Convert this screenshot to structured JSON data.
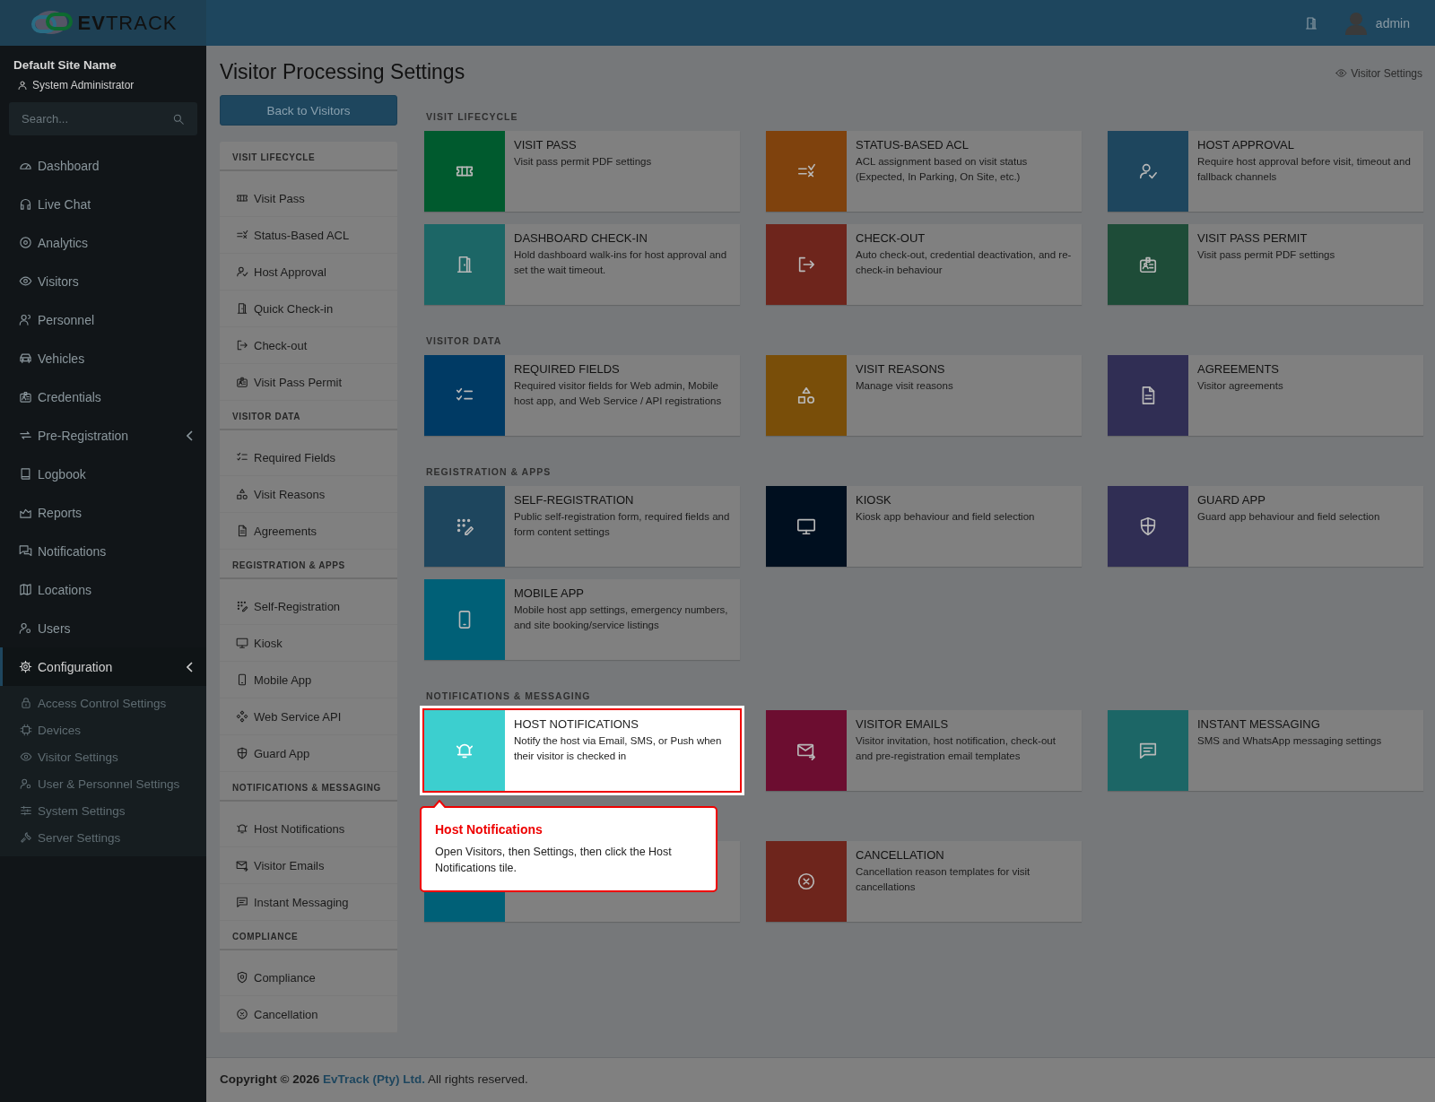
{
  "header": {
    "brand": "**EV**TRACK",
    "user": "admin"
  },
  "sidebar": {
    "site_name": "Default Site Name",
    "role": "System Administrator",
    "search": {
      "placeholder": "Search..."
    },
    "items": [
      {
        "label": "Dashboard",
        "kind": "link",
        "selected": false
      },
      {
        "label": "Live Chat",
        "kind": "link",
        "selected": false
      },
      {
        "label": "Analytics",
        "kind": "link",
        "selected": false
      },
      {
        "label": "Visitors",
        "kind": "link",
        "selected": false
      },
      {
        "label": "Personnel",
        "kind": "link",
        "selected": false
      },
      {
        "label": "Vehicles",
        "kind": "link",
        "selected": false
      },
      {
        "label": "Credentials",
        "kind": "link",
        "selected": false
      },
      {
        "label": "Pre-Registration",
        "kind": "group",
        "selected": false
      },
      {
        "label": "Logbook",
        "kind": "link",
        "selected": false
      },
      {
        "label": "Reports",
        "kind": "link",
        "selected": false
      },
      {
        "label": "Notifications",
        "kind": "link",
        "selected": false
      },
      {
        "label": "Locations",
        "kind": "link",
        "selected": false
      },
      {
        "label": "Users",
        "kind": "link",
        "selected": false
      },
      {
        "label": "Configuration",
        "kind": "group",
        "selected": true,
        "children": [
          {
            "label": "Access Control Settings",
            "selected": false
          },
          {
            "label": "Devices",
            "selected": false
          },
          {
            "label": "Visitor Settings",
            "selected": false
          },
          {
            "label": "User & Personnel Settings",
            "selected": false
          },
          {
            "label": "System Settings",
            "selected": false
          },
          {
            "label": "Server Settings",
            "selected": false
          }
        ]
      }
    ]
  },
  "page": {
    "title": "Visitor Processing Settings",
    "breadcrumb": "Visitor Settings",
    "back_button": "Back to Visitors"
  },
  "settings_nav": [
    {
      "heading": "VISIT LIFECYCLE",
      "items": [
        "Visit Pass",
        "Status-Based ACL",
        "Host Approval",
        "Quick Check-in",
        "Check-out",
        "Visit Pass Permit"
      ]
    },
    {
      "heading": "VISITOR DATA",
      "items": [
        "Required Fields",
        "Visit Reasons",
        "Agreements"
      ]
    },
    {
      "heading": "REGISTRATION & APPS",
      "items": [
        "Self-Registration",
        "Kiosk",
        "Mobile App",
        "Web Service API",
        "Guard App"
      ]
    },
    {
      "heading": "NOTIFICATIONS & MESSAGING",
      "items": [
        "Host Notifications",
        "Visitor Emails",
        "Instant Messaging"
      ]
    },
    {
      "heading": "COMPLIANCE",
      "items": [
        "Compliance",
        "Cancellation"
      ]
    }
  ],
  "tile_sections": [
    {
      "heading": "VISIT LIFECYCLE",
      "tiles": [
        {
          "title": "VISIT PASS",
          "description": "Visit pass permit PDF settings",
          "color": "#005a2e",
          "highlighted": false
        },
        {
          "title": "STATUS-BASED ACL",
          "description": "ACL assignment based on visit status (Expected, In Parking, On Site, etc.)",
          "color": "#7f420d",
          "highlighted": false
        },
        {
          "title": "HOST APPROVAL",
          "description": "Require host approval before visit, timeout and fallback channels",
          "color": "#1e465e",
          "highlighted": false
        },
        {
          "title": "DASHBOARD CHECK-IN",
          "description": "Hold dashboard walk-ins for host approval and set the wait timeout.",
          "color": "#1c6666",
          "highlighted": false
        },
        {
          "title": "CHECK-OUT",
          "description": "Auto check-out, credential deactivation, and re-check-in behaviour",
          "color": "#6e251c",
          "highlighted": false
        },
        {
          "title": "VISIT PASS PERMIT",
          "description": "Visit pass permit PDF settings",
          "color": "#1e4c38",
          "highlighted": false
        }
      ]
    },
    {
      "heading": "VISITOR DATA",
      "tiles": [
        {
          "title": "REQUIRED FIELDS",
          "description": "Required visitor fields for Web admin, Mobile host app, and Web Service / API registrations",
          "color": "#003a64",
          "highlighted": false
        },
        {
          "title": "VISIT REASONS",
          "description": "Manage visit reasons",
          "color": "#794e09",
          "highlighted": false
        },
        {
          "title": "AGREEMENTS",
          "description": "Visitor agreements",
          "color": "#302e54",
          "highlighted": false
        }
      ]
    },
    {
      "heading": "REGISTRATION & APPS",
      "tiles": [
        {
          "title": "SELF-REGISTRATION",
          "description": "Public self-registration form, required fields and form content settings",
          "color": "#1e465e",
          "highlighted": false
        },
        {
          "title": "KIOSK",
          "description": "Kiosk app behaviour and field selection",
          "color": "#000f1f",
          "highlighted": false
        },
        {
          "title": "GUARD APP",
          "description": "Guard app behaviour and field selection",
          "color": "#302e54",
          "highlighted": false
        },
        {
          "title": "MOBILE APP",
          "description": "Mobile host app settings, emergency numbers, and site booking/service listings",
          "color": "#006077",
          "highlighted": false
        }
      ]
    },
    {
      "heading": "NOTIFICATIONS & MESSAGING",
      "tiles": [
        {
          "title": "HOST NOTIFICATIONS",
          "description": "Notify the host via Email, SMS, or Push when their visitor is checked in",
          "color": "#3ccfcf",
          "highlighted": true
        },
        {
          "title": "VISITOR EMAILS",
          "description": "Visitor invitation, host notification, check-out and pre-registration email templates",
          "color": "#6c0d30",
          "highlighted": false
        },
        {
          "title": "INSTANT MESSAGING",
          "description": "SMS and WhatsApp messaging settings",
          "color": "#1c6666",
          "highlighted": false
        }
      ]
    },
    {
      "tiles": [
        {
          "color": "#006077",
          "highlighted": false
        },
        {
          "title": "CANCELLATION",
          "description": "Cancellation reason templates for visit cancellations",
          "color": "#6e251c",
          "highlighted": false
        }
      ]
    }
  ],
  "tour": {
    "title": "Host Notifications",
    "text": "Open Visitors, then Settings, then click the Host Notifications tile."
  },
  "footer": {
    "copyright": "Copyright © 2026",
    "company": "EvTrack (Pty) Ltd.",
    "rights": "All rights reserved."
  }
}
